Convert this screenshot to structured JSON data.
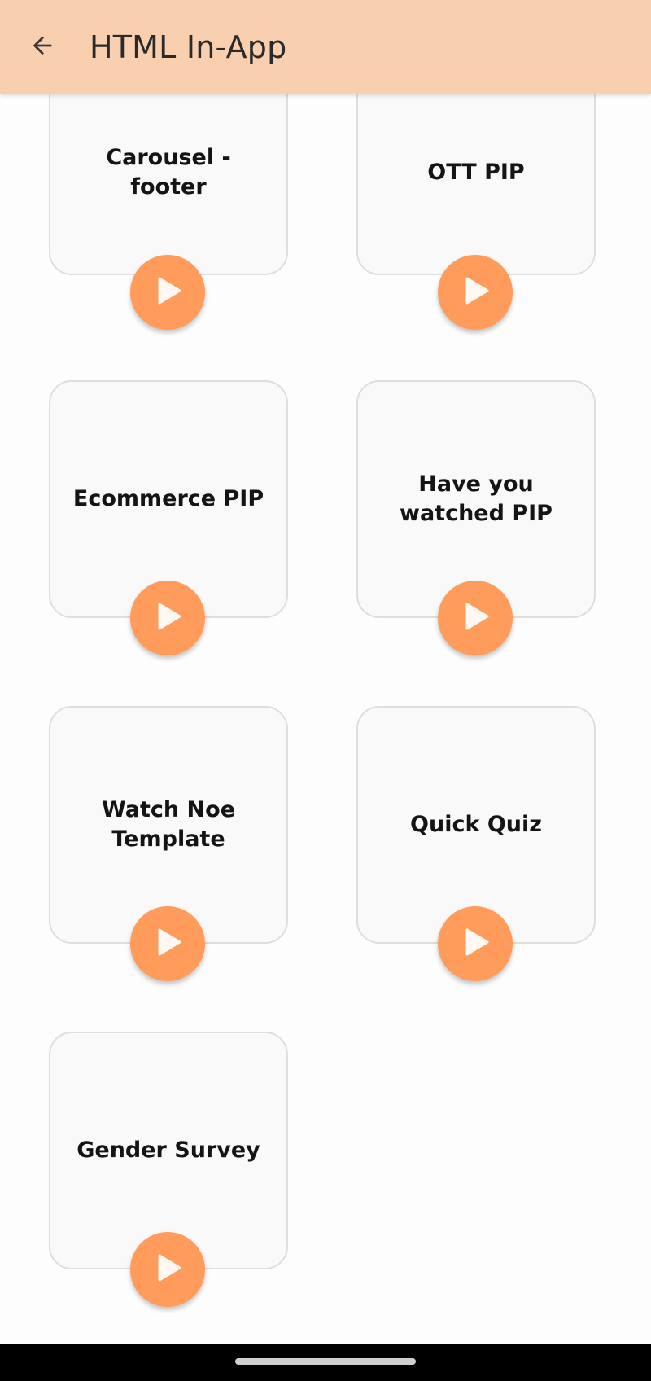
{
  "appbar": {
    "title": "HTML In-App",
    "back_icon": "arrow-left-icon"
  },
  "templates": [
    {
      "label": "Carousel -\nfooter",
      "play_icon": "play-icon"
    },
    {
      "label": "OTT PIP",
      "play_icon": "play-icon"
    },
    {
      "label": "Ecommerce PIP",
      "play_icon": "play-icon"
    },
    {
      "label": "Have you\nwatched PIP",
      "play_icon": "play-icon"
    },
    {
      "label": "Watch Noe\nTemplate",
      "play_icon": "play-icon"
    },
    {
      "label": "Quick Quiz",
      "play_icon": "play-icon"
    },
    {
      "label": "Gender Survey",
      "play_icon": "play-icon"
    }
  ],
  "colors": {
    "appbar": "#f8d0b0",
    "play_button": "#ff9c5c",
    "card_background": "#f9f9f9",
    "card_border": "#dedede"
  }
}
